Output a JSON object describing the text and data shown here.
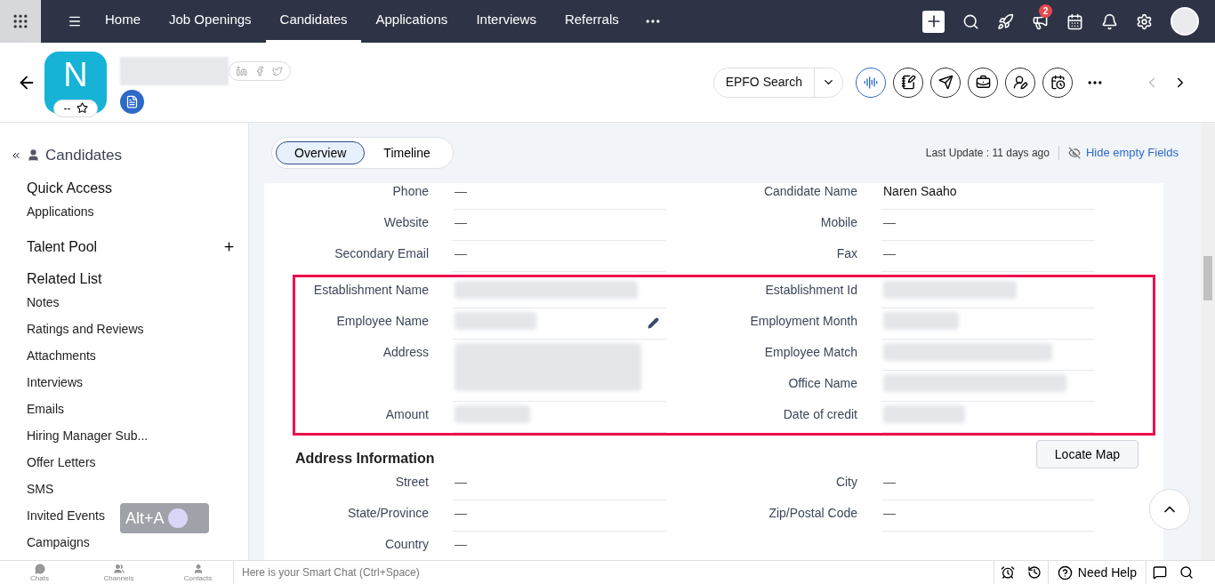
{
  "nav": {
    "items": [
      {
        "label": "Home",
        "selected": false
      },
      {
        "label": "Job Openings",
        "selected": false
      },
      {
        "label": "Candidates",
        "selected": true
      },
      {
        "label": "Applications",
        "selected": false
      },
      {
        "label": "Interviews",
        "selected": false
      },
      {
        "label": "Referrals",
        "selected": false
      }
    ],
    "badge": "2"
  },
  "header": {
    "initial": "N",
    "rating": "--",
    "epfo_button": "EPFO Search"
  },
  "sidebar": {
    "title": "Candidates",
    "sections": [
      {
        "heading": "Quick Access",
        "items": [
          "Applications"
        ],
        "addable": false
      },
      {
        "heading": "Talent Pool",
        "addable": true
      },
      {
        "heading": "Related List",
        "items": [
          "Notes",
          "Ratings and Reviews",
          "Attachments",
          "Interviews",
          "Emails",
          "Hiring Manager Sub...",
          "Offer Letters",
          "SMS",
          "Invited Events",
          "Campaigns"
        ],
        "addable": false
      }
    ]
  },
  "shortcut": "Alt+A",
  "tabs": [
    {
      "label": "Overview",
      "selected": true
    },
    {
      "label": "Timeline",
      "selected": false
    }
  ],
  "last_update": "Last Update : 11 days ago",
  "hide_empty": "Hide empty Fields",
  "groups": [
    {
      "highlighted": false,
      "left": [
        {
          "label": "Phone",
          "kind": "text",
          "value": "—"
        },
        {
          "label": "Website",
          "kind": "text",
          "value": "—"
        },
        {
          "label": "Secondary Email",
          "kind": "text",
          "value": "—"
        }
      ],
      "right": [
        {
          "label": "Candidate Name",
          "kind": "text",
          "value": "Naren Saaho"
        },
        {
          "label": "Mobile",
          "kind": "text",
          "value": "—"
        },
        {
          "label": "Fax",
          "kind": "text",
          "value": "—"
        }
      ]
    },
    {
      "highlighted": true,
      "left": [
        {
          "label": "Establishment Name",
          "kind": "redacted"
        },
        {
          "label": "Employee Name",
          "kind": "redacted-editable"
        },
        {
          "label": "Address",
          "kind": "redacted-tall"
        },
        {
          "label": "Amount",
          "kind": "redacted"
        }
      ],
      "right": [
        {
          "label": "Establishment Id",
          "kind": "redacted"
        },
        {
          "label": "Employment Month",
          "kind": "redacted"
        },
        {
          "label": "Employee Match",
          "kind": "redacted"
        },
        {
          "label": "Office Name",
          "kind": "redacted"
        },
        {
          "label": "Date of credit",
          "kind": "redacted"
        }
      ]
    }
  ],
  "address": {
    "title": "Address Information",
    "button": "Locate Map",
    "left": [
      {
        "label": "Street",
        "kind": "text",
        "value": "—"
      },
      {
        "label": "State/Province",
        "kind": "text",
        "value": "—"
      },
      {
        "label": "Country",
        "kind": "text",
        "value": "—"
      }
    ],
    "right": [
      {
        "label": "City",
        "kind": "text",
        "value": "—"
      },
      {
        "label": "Zip/Postal Code",
        "kind": "text",
        "value": "—"
      }
    ]
  },
  "bottom": {
    "apps": [
      "Chats",
      "Channels",
      "Contacts"
    ],
    "chat_placeholder": "Here is your Smart Chat (Ctrl+Space)",
    "help": "Need Help"
  }
}
